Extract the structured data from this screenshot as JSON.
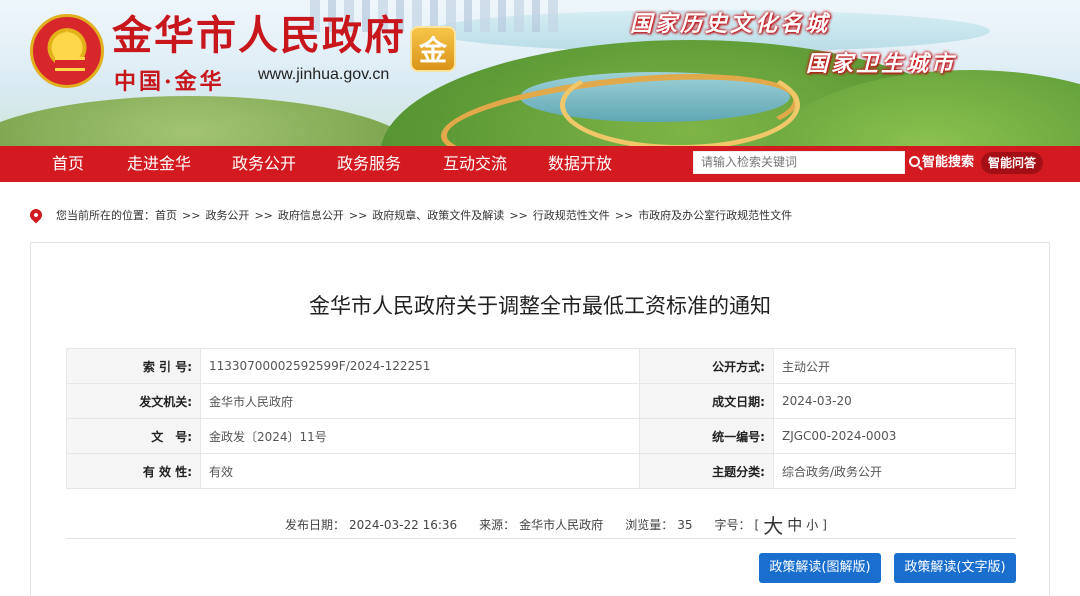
{
  "header": {
    "site_title": "金华市人民政府",
    "badge_char": "金",
    "sub_title": "中国·金华",
    "url": "www.jinhua.gov.cn",
    "slogan_1": "国家历史文化名城",
    "slogan_2": "国家卫生城市"
  },
  "nav": {
    "items": [
      "首页",
      "走进金华",
      "政务公开",
      "政务服务",
      "互动交流",
      "数据开放"
    ],
    "search_placeholder": "请输入检索关键词",
    "search_button": "智能搜索",
    "qa_button": "智能问答"
  },
  "breadcrumb": {
    "prefix": "您当前所在的位置：",
    "items": [
      "首页",
      "政务公开",
      "政府信息公开",
      "政府规章、政策文件及解读",
      "行政规范性文件",
      "市政府及办公室行政规范性文件"
    ],
    "separator": ">>"
  },
  "article": {
    "title": "金华市人民政府关于调整全市最低工资标准的通知",
    "meta": [
      {
        "k1": "索 引 号:",
        "v1": "11330700002592599F/2024-122251",
        "k2": "公开方式:",
        "v2": "主动公开"
      },
      {
        "k1": "发文机关:",
        "v1": "金华市人民政府",
        "k2": "成文日期:",
        "v2": "2024-03-20"
      },
      {
        "k1": "文　号:",
        "v1": "金政发〔2024〕11号",
        "k2": "统一编号:",
        "v2": "ZJGC00-2024-0003"
      },
      {
        "k1": "有 效 性:",
        "v1": "有效",
        "k2": "主题分类:",
        "v2": "综合政务/政务公开"
      }
    ],
    "publish_label": "发布日期：",
    "publish_date": "2024-03-22 16:36",
    "source_label": "来源：",
    "source": "金华市人民政府",
    "views_label": "浏览量：",
    "views": "35",
    "font_label": "字号：",
    "bracket_open": "[",
    "font_large": "大",
    "font_medium": "中",
    "font_small": "小",
    "bracket_close": "]",
    "btn_graphic": "政策解读(图解版)",
    "btn_text": "政策解读(文字版)"
  },
  "colors": {
    "nav_red": "#d21a20",
    "title_red": "#c8161d",
    "button_blue": "#1a6fce"
  }
}
